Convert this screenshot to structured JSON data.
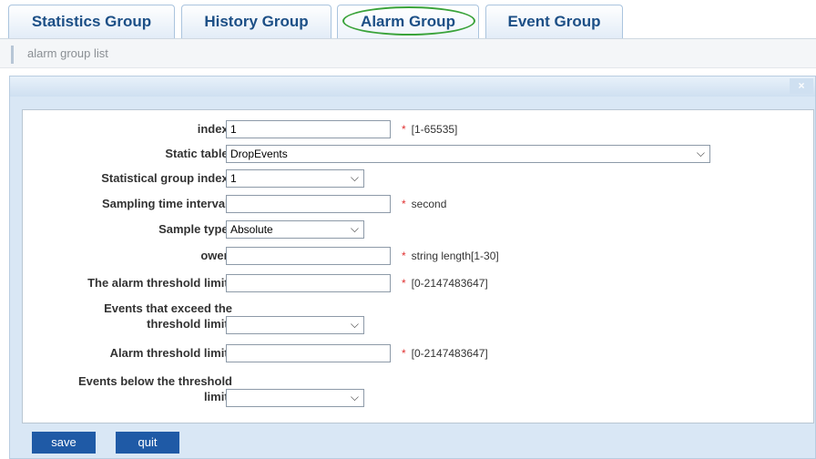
{
  "tabs": [
    {
      "label": "Statistics Group"
    },
    {
      "label": "History Group"
    },
    {
      "label": "Alarm Group"
    },
    {
      "label": "Event Group"
    }
  ],
  "breadcrumb": "alarm group list",
  "dialog": {
    "close_label": "×"
  },
  "form": {
    "index": {
      "label": "index:",
      "value": "1",
      "hint": "[1-65535]"
    },
    "static_table": {
      "label": "Static table:",
      "value": "DropEvents"
    },
    "stat_group_index": {
      "label": "Statistical group index:",
      "value": "1"
    },
    "sampling_interval": {
      "label": "Sampling time interval:",
      "value": "",
      "hint": "second"
    },
    "sample_type": {
      "label": "Sample type:",
      "value": "Absolute"
    },
    "owner": {
      "label": "ower:",
      "value": "",
      "hint": "string length[1-30]"
    },
    "alarm_threshold_upper": {
      "label": "The alarm threshold limit:",
      "value": "",
      "hint": "[0-2147483647]"
    },
    "events_exceed": {
      "label_line1": "Events that exceed the",
      "label_line2": "threshold limit:",
      "value": ""
    },
    "alarm_threshold_lower": {
      "label": "Alarm threshold limit:",
      "value": "",
      "hint": "[0-2147483647]"
    },
    "events_below": {
      "label_line1": "Events below the threshold",
      "label_line2": "limit:",
      "value": ""
    }
  },
  "required_mark": "*",
  "chevron": "⌵",
  "buttons": {
    "save": "save",
    "quit": "quit"
  }
}
